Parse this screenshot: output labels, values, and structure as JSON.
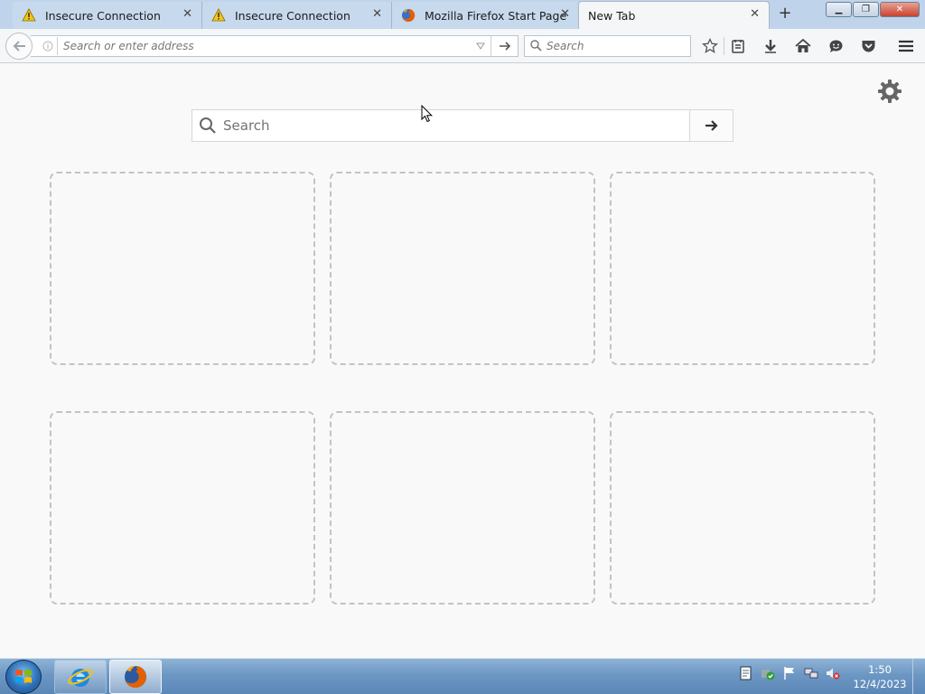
{
  "tabs": [
    {
      "label": "Insecure Connection",
      "icon": "warning-icon",
      "active": false
    },
    {
      "label": "Insecure Connection",
      "icon": "warning-icon",
      "active": false
    },
    {
      "label": "Mozilla Firefox Start Page",
      "icon": "firefox-icon",
      "active": false
    },
    {
      "label": "New Tab",
      "icon": "",
      "active": true
    }
  ],
  "tab_close_glyph": "✕",
  "new_tab_glyph": "+",
  "window_controls": {
    "minimize": "▁",
    "maximize": "❐",
    "close": "✕"
  },
  "navbar": {
    "url_placeholder": "Search or enter address",
    "search_placeholder": "Search"
  },
  "content": {
    "search_placeholder": "Search",
    "tiles_count": 6
  },
  "taskbar": {
    "clock_time": "1:50",
    "clock_date": "12/4/2023",
    "apps": [
      "internet-explorer",
      "firefox"
    ]
  },
  "colors": {
    "tabstrip": "#bfd4ea",
    "tile_border": "#c3c3c3",
    "taskbar": "#6d97c3"
  }
}
